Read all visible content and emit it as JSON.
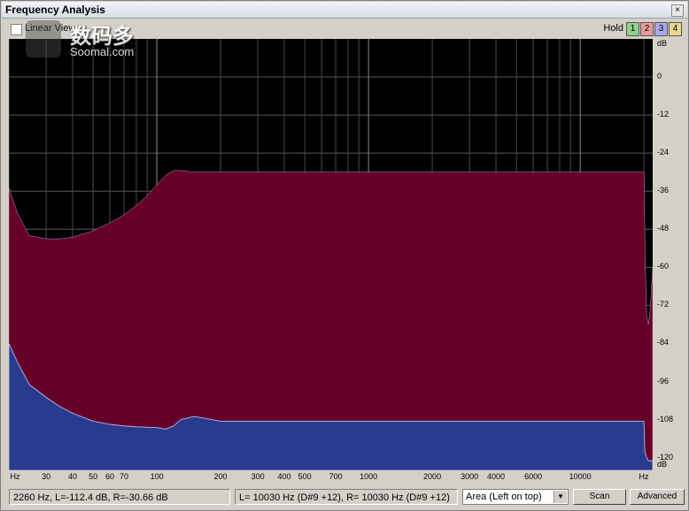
{
  "window": {
    "title": "Frequency Analysis",
    "close_label": "×"
  },
  "toolbar": {
    "linear_view_label": "Linear View",
    "hold_label": "Hold",
    "hold_buttons": [
      {
        "label": "1",
        "color": "#8fd08f"
      },
      {
        "label": "2",
        "color": "#e89a9a"
      },
      {
        "label": "3",
        "color": "#a8a8ee"
      },
      {
        "label": "4",
        "color": "#e8d890"
      }
    ]
  },
  "watermark": {
    "text_cn": "数码多",
    "text_en": "Soomal.com"
  },
  "y_axis": {
    "labels": [
      "dB",
      "0",
      "-12",
      "-24",
      "-36",
      "-48",
      "-60",
      "-72",
      "-84",
      "-96",
      "-108",
      "-120",
      "dB"
    ]
  },
  "x_axis": {
    "labels": [
      "Hz",
      "30",
      "40",
      "50",
      "60",
      "70",
      "100",
      "200",
      "300",
      "400",
      "500",
      "700",
      "1000",
      "2000",
      "3000",
      "4000",
      "6000",
      "10000",
      "Hz"
    ]
  },
  "chart_data": {
    "type": "area",
    "x_scale": "log",
    "y_unit": "dB",
    "ylim": [
      -124,
      12
    ],
    "xlim": [
      20,
      22000
    ],
    "series": [
      {
        "color": "#660029",
        "x": [
          20,
          22,
          25,
          30,
          35,
          40,
          50,
          60,
          70,
          80,
          90,
          100,
          110,
          120,
          130,
          150,
          200,
          500,
          1000,
          5000,
          10000,
          20000,
          20100,
          20300,
          20600,
          21000,
          21500,
          22000
        ],
        "y": [
          -35,
          -43,
          -50,
          -51,
          -51,
          -50.5,
          -48.5,
          -46,
          -43.5,
          -40.5,
          -37.5,
          -34,
          -31,
          -29.5,
          -29.5,
          -30,
          -30,
          -30,
          -30,
          -30,
          -30,
          -30,
          -40,
          -60,
          -75,
          -78,
          -72,
          -60
        ]
      },
      {
        "color": "#2a3a8c",
        "x": [
          20,
          22,
          25,
          30,
          35,
          40,
          50,
          60,
          70,
          80,
          100,
          110,
          120,
          130,
          150,
          200,
          500,
          1000,
          5000,
          10000,
          20000,
          20200,
          20600,
          21000,
          22000
        ],
        "y": [
          -84,
          -90,
          -97,
          -101,
          -104,
          -106,
          -108.5,
          -109.5,
          -110,
          -110.3,
          -110.5,
          -111,
          -110,
          -108,
          -107,
          -108.5,
          -108.5,
          -108.5,
          -108.5,
          -108.5,
          -108.5,
          -118,
          -120,
          -121,
          -121
        ]
      }
    ]
  },
  "status": {
    "cursor_readout": "2260 Hz, L=-112.4 dB, R=-30.66 dB",
    "peak_readout": "L=  10030 Hz (D#9 +12), R=  10030 Hz (D#9 +12)",
    "display_mode": "Area (Left on top)",
    "scan_label": "Scan",
    "advanced_label": "Advanced"
  }
}
